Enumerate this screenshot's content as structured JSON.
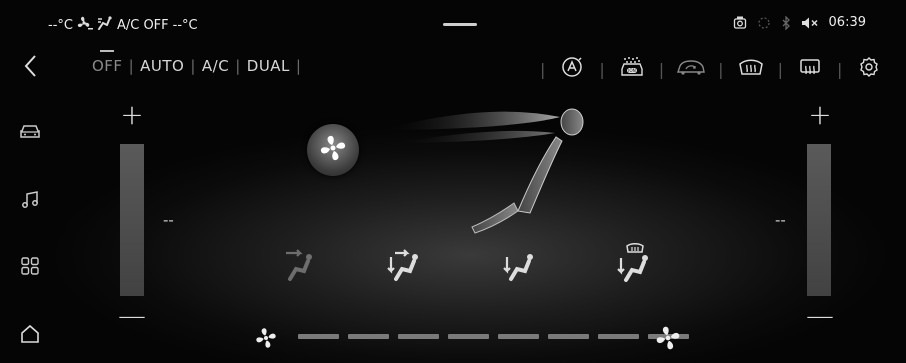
{
  "status_bar": {
    "left_temp": "--°C",
    "ac_status": "A/C OFF",
    "right_temp": "--°C",
    "time": "06:39",
    "icons": [
      "fan-icon",
      "seat-airflow-icon",
      "driving-recorder-icon",
      "loading-icon",
      "bluetooth-icon",
      "mute-icon"
    ]
  },
  "nav": {
    "back_icon": "chevron-left-icon",
    "items": [
      "car-icon",
      "music-icon",
      "apps-grid-icon",
      "home-icon"
    ]
  },
  "modes": {
    "items": [
      "OFF",
      "AUTO",
      "A/C",
      "DUAL"
    ],
    "selected": "OFF"
  },
  "toolbar": {
    "items": [
      "auto-recirculation-icon",
      "air-purifier-icon",
      "recirculation-icon",
      "front-defrost-icon",
      "rear-defrost-icon",
      "settings-icon"
    ]
  },
  "climate": {
    "left_temp_value": "--",
    "right_temp_value": "--",
    "plus": "+",
    "minus": "—"
  },
  "airflow_modes": [
    "face-airflow-icon",
    "face-feet-airflow-icon",
    "feet-airflow-icon",
    "feet-defrost-airflow-icon"
  ],
  "fan": {
    "segments": 8,
    "level": 0
  }
}
